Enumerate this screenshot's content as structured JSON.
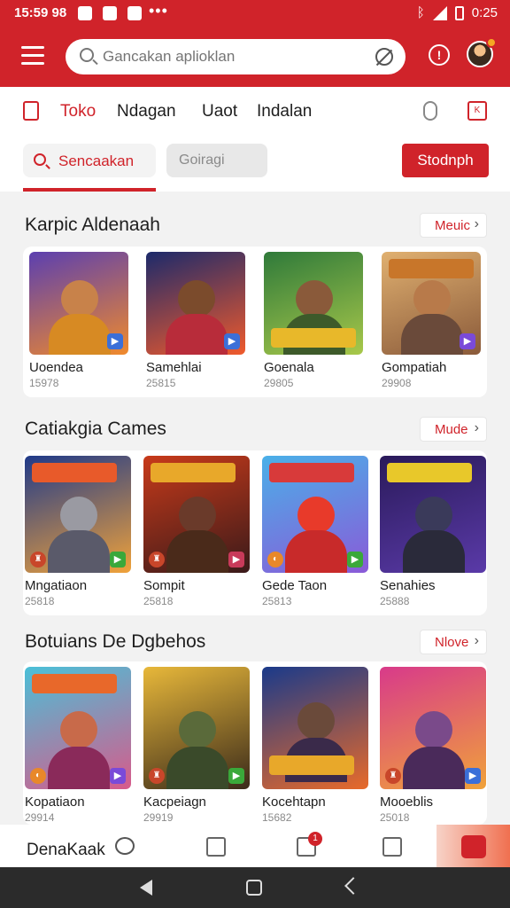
{
  "status_bar": {
    "time": "15:59 98",
    "battery": "0:25"
  },
  "app_bar": {
    "search_placeholder": "Gancakan aplioklan"
  },
  "tabs": [
    {
      "label": "Toko",
      "active": true
    },
    {
      "label": "Ndagan",
      "active": false
    },
    {
      "label": "Uaot",
      "active": false
    },
    {
      "label": "Indalan",
      "active": false
    }
  ],
  "filters": {
    "search_chip": "Sencaakan",
    "category_chip": "Goiragi",
    "store_button": "Stodnph"
  },
  "sections": [
    {
      "title": "Karpic Aldenaah",
      "more": "Meuic",
      "games": [
        {
          "name": "Uoendea",
          "count": "15978"
        },
        {
          "name": "Samehlai",
          "count": "25815"
        },
        {
          "name": "Goenala",
          "count": "29805"
        },
        {
          "name": "Gompatiah",
          "count": "29908"
        }
      ]
    },
    {
      "title": "Catiakgia Cames",
      "more": "Mude",
      "games": [
        {
          "name": "Mngatiaon",
          "count": "25818"
        },
        {
          "name": "Sompit",
          "count": "25818"
        },
        {
          "name": "Gede Taon",
          "count": "25813"
        },
        {
          "name": "Senahies",
          "count": "25888"
        }
      ]
    },
    {
      "title": "Botuians De Dgbehos",
      "more": "Nlove",
      "games": [
        {
          "name": "Kopatiaon",
          "count": "29914"
        },
        {
          "name": "Kacpeiagn",
          "count": "29919"
        },
        {
          "name": "Kocehtapn",
          "count": "15682"
        },
        {
          "name": "Mooeblis",
          "count": "25018"
        }
      ]
    }
  ],
  "bottom_nav": {
    "label": "DenaKaak",
    "badge": "1"
  },
  "colors": {
    "accent": "#d0232a"
  }
}
